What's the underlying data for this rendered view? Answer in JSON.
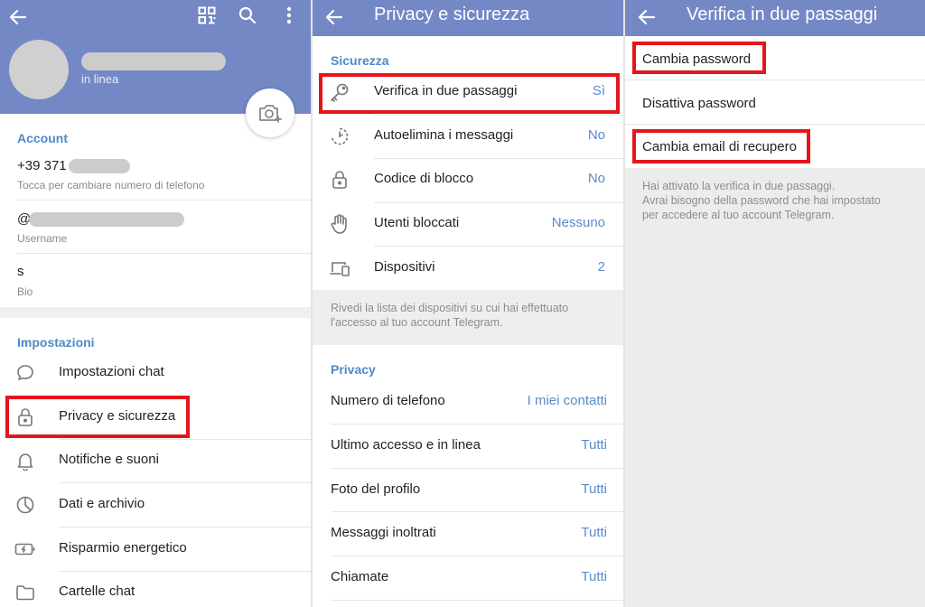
{
  "colors": {
    "header": "#7488c6",
    "accent": "#4d8ac9",
    "value": "#5b8bc9",
    "highlight": "#e3161c"
  },
  "panel1": {
    "header": {
      "status": "in linea",
      "icons": [
        "back-arrow-icon",
        "qr-code-icon",
        "search-icon",
        "more-vertical-icon"
      ]
    },
    "account": {
      "title": "Account",
      "phone": "+39 371",
      "phone_hint": "Tocca per cambiare numero di telefono",
      "username_prefix": "@",
      "username_label": "Username",
      "bio": "s",
      "bio_label": "Bio"
    },
    "settings": {
      "title": "Impostazioni",
      "items": [
        {
          "label": "Impostazioni chat",
          "icon": "chat-bubble-icon"
        },
        {
          "label": "Privacy e sicurezza",
          "icon": "lock-icon"
        },
        {
          "label": "Notifiche e suoni",
          "icon": "bell-icon"
        },
        {
          "label": "Dati e archivio",
          "icon": "pie-chart-icon"
        },
        {
          "label": "Risparmio energetico",
          "icon": "battery-icon"
        },
        {
          "label": "Cartelle chat",
          "icon": "folder-icon"
        }
      ]
    }
  },
  "panel2": {
    "title": "Privacy e sicurezza",
    "security": {
      "title": "Sicurezza",
      "items": [
        {
          "label": "Verifica in due passaggi",
          "value": "Sì",
          "icon": "key-icon"
        },
        {
          "label": "Autoelimina i messaggi",
          "value": "No",
          "icon": "timer-icon"
        },
        {
          "label": "Codice di blocco",
          "value": "No",
          "icon": "lock-icon"
        },
        {
          "label": "Utenti bloccati",
          "value": "Nessuno",
          "icon": "hand-icon"
        },
        {
          "label": "Dispositivi",
          "value": "2",
          "icon": "devices-icon"
        }
      ],
      "note": "Rivedi la lista dei dispositivi su cui hai effettuato l'accesso al tuo account Telegram."
    },
    "privacy": {
      "title": "Privacy",
      "items": [
        {
          "label": "Numero di telefono",
          "value": "I miei contatti"
        },
        {
          "label": "Ultimo accesso e in linea",
          "value": "Tutti"
        },
        {
          "label": "Foto del profilo",
          "value": "Tutti"
        },
        {
          "label": "Messaggi inoltrati",
          "value": "Tutti"
        },
        {
          "label": "Chiamate",
          "value": "Tutti"
        }
      ]
    }
  },
  "panel3": {
    "title": "Verifica in due passaggi",
    "options": [
      "Cambia password",
      "Disattiva password",
      "Cambia email di recupero"
    ],
    "note_line1": "Hai attivato la verifica in due passaggi.",
    "note_line2": "Avrai bisogno della password che hai impostato",
    "note_line3": "per accedere al tuo account Telegram."
  }
}
